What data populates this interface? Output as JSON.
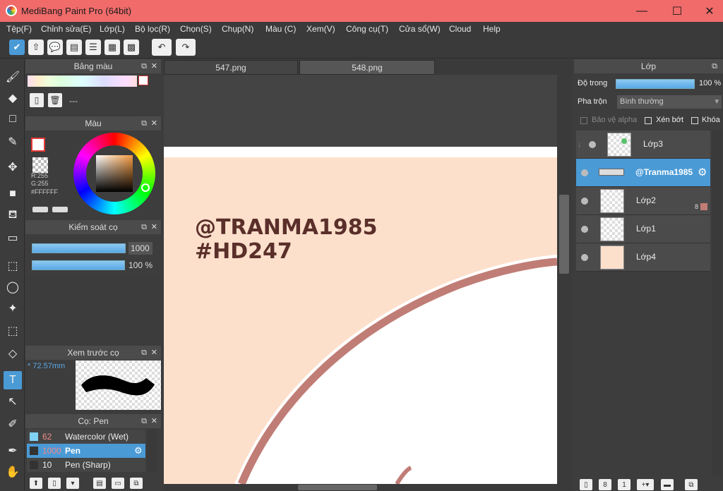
{
  "window": {
    "title": "MediBang Paint Pro (64bit)",
    "minimize": "—",
    "maximize": "☐",
    "close": "✕"
  },
  "menu": [
    "Tệp(F)",
    "Chỉnh sửa(E)",
    "Lớp(L)",
    "Bộ lọc(R)",
    "Chọn(S)",
    "Chụp(N)",
    "Màu (C)",
    "Xem(V)",
    "Công cụ(T)",
    "Cửa sổ(W)",
    "Cloud",
    "Help"
  ],
  "tabs": [
    "547.png",
    "548.png"
  ],
  "palette_panel": {
    "title": "Bảng màu",
    "name_value": "---"
  },
  "color_panel": {
    "title": "Màu",
    "r_label": "R:255",
    "g_label": "G:255",
    "hex_label": "#FFFFFF",
    "primary_color": "#ffffff",
    "accent": "#e53935"
  },
  "brush_control": {
    "title": "Kiểm soát cọ",
    "size_value": "1000",
    "opacity_value": "100 %"
  },
  "brush_preview": {
    "title": "Xem trước cọ",
    "size_label": "* 72.57mm"
  },
  "brush_list": {
    "title": "Cọ: Pen",
    "items": [
      {
        "size": "62",
        "name": "Watercolor (Wet)",
        "swatch": "#7fd3f5",
        "selected": false
      },
      {
        "size": "1000",
        "name": "Pen",
        "swatch": "#333333",
        "selected": true
      },
      {
        "size": "10",
        "name": "Pen (Sharp)",
        "swatch": "#333333",
        "selected": false
      }
    ]
  },
  "canvas": {
    "text_line1": "@TRANMA1985",
    "text_line2": "#HD247",
    "background": "#fde0cc",
    "ring_color": "#c07d76"
  },
  "layers_panel": {
    "title": "Lớp",
    "opacity_label": "Độ trong",
    "opacity_value": "100 %",
    "blend_label": "Pha trộn",
    "blend_value": "Bình thường",
    "protect_alpha": "Bảo vệ alpha",
    "clipping": "Xén bớt",
    "lock": "Khóa",
    "layers": [
      {
        "name": "Lớp3",
        "selected": false,
        "badge": ""
      },
      {
        "name": "@Tranma1985",
        "selected": true,
        "badge": ""
      },
      {
        "name": "Lớp2",
        "selected": false,
        "badge": "8"
      },
      {
        "name": "Lớp1",
        "selected": false,
        "badge": ""
      },
      {
        "name": "Lớp4",
        "selected": false,
        "badge": ""
      }
    ]
  }
}
